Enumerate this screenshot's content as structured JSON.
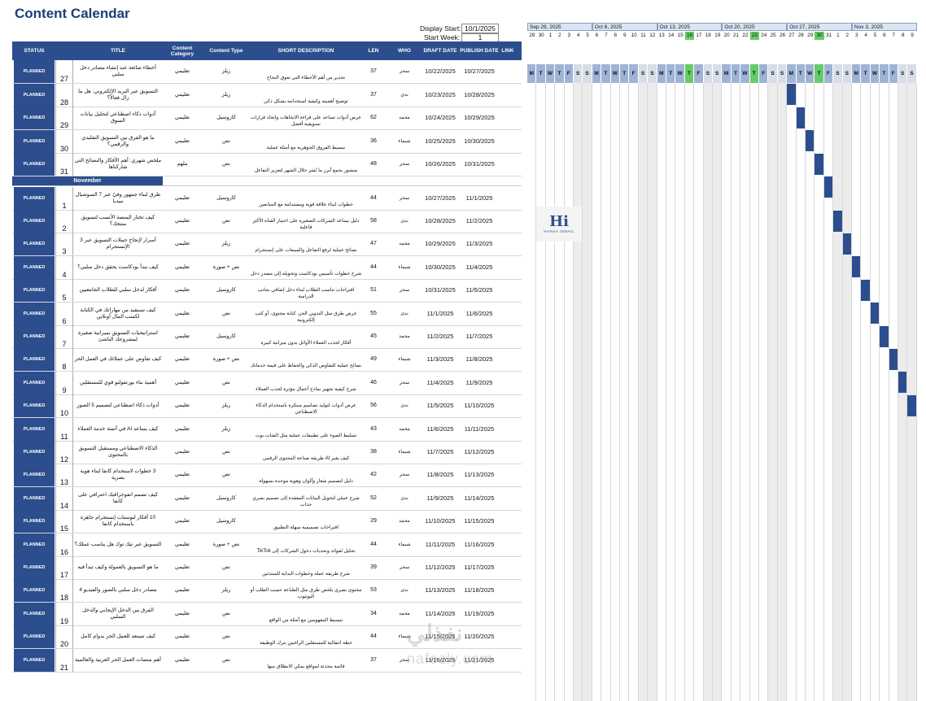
{
  "page_title": "Content Calendar",
  "display_start_label": "Display Start:",
  "display_start_value": "10/1/2025",
  "start_week_label": "Start Week:",
  "start_week_value": "1",
  "columns": [
    "STATUS",
    "TITLE",
    "Content Category",
    "Content Type",
    "SHORT DESCRIPTION",
    "LEN",
    "WHO",
    "DRAFT DATE",
    "PUBLISH DATE",
    "LINK"
  ],
  "month_label": "November",
  "week_labels": [
    "Sep 29, 2025",
    "Oct 6, 2025",
    "Oct 13, 2025",
    "Oct 20, 2025",
    "Oct 27, 2025",
    "Nov 3, 2025"
  ],
  "day_numbers": [
    "29",
    "30",
    "1",
    "2",
    "3",
    "4",
    "5",
    "6",
    "7",
    "8",
    "9",
    "10",
    "11",
    "12",
    "13",
    "14",
    "15",
    "16",
    "17",
    "18",
    "19",
    "20",
    "21",
    "22",
    "23",
    "24",
    "25",
    "26",
    "27",
    "28",
    "29",
    "30",
    "31",
    "1",
    "2",
    "3",
    "4",
    "5",
    "6",
    "7",
    "8",
    "9"
  ],
  "day_letters": [
    "M",
    "T",
    "W",
    "T",
    "F",
    "S",
    "S"
  ],
  "colors": {
    "header": "#2c4e8f",
    "today": "#66cc66",
    "weekend": "#ececec",
    "bar": "#2c4e8f"
  },
  "logo": {
    "mark": "Hi",
    "text": "HANAA ISMAIL"
  },
  "watermark": {
    "arabic": "نفذلي",
    "latin": "nafezly.com"
  },
  "rows_oct": [
    {
      "status": "PLANNED",
      "num": "27",
      "title": "أخطاء شائعة عند إنشاء مصادر دخل سلبي",
      "category": "تعليمي",
      "type": "ريلز",
      "desc": "تحذير من أهم الأخطاء التي تعوق النجاح",
      "len": "37",
      "who": "سحر",
      "draft": "10/22/2025",
      "publish": "10/27/2025"
    },
    {
      "status": "PLANNED",
      "num": "28",
      "title": "التسويق عبر البريد الإلكتروني: هل ما زال فعالاً؟",
      "category": "تعليمي",
      "type": "ريلز",
      "desc": "توضيح أهميته وكيفية استخدامه بشكل ذكي",
      "len": "37",
      "who": "ندى",
      "draft": "10/23/2025",
      "publish": "10/28/2025"
    },
    {
      "status": "PLANNED",
      "num": "29",
      "title": "أدوات ذكاء اصطناعي لتحليل بيانات السوق",
      "category": "تعليمي",
      "type": "كاروسيل",
      "desc": "عرض أدوات تساعد على قراءة الاتجاهات واتخاذ قرارات تسويقية أفضل",
      "len": "62",
      "who": "محمد",
      "draft": "10/24/2025",
      "publish": "10/29/2025"
    },
    {
      "status": "PLANNED",
      "num": "30",
      "title": "ما هو الفرق بين التسويق التقليدي والرقمي؟",
      "category": "تعليمي",
      "type": "نص",
      "desc": "تبسيط الفروق الجوهرية مع أمثلة عملية",
      "len": "36",
      "who": "شيماء",
      "draft": "10/25/2025",
      "publish": "10/30/2025"
    },
    {
      "status": "PLANNED",
      "num": "31",
      "title": "ملخص شهري: أهم الأفكار والنصائح التي شاركناها",
      "category": "ملهم",
      "type": "نص",
      "desc": "منشور يجمع أبرز ما نُشر خلال الشهر لتعزيز التفاعل",
      "len": "48",
      "who": "سحر",
      "draft": "10/26/2025",
      "publish": "10/31/2025"
    }
  ],
  "rows_nov": [
    {
      "status": "PLANNED",
      "num": "1",
      "title": "طرق لبناء جمهور وفيّ عبر 7 السوشيال ميديا",
      "category": "تعليمي",
      "type": "كاروسيل",
      "desc": "خطوات لبناء علاقة قوية ومستدامة مع المتابعين",
      "len": "44",
      "who": "سحر",
      "draft": "10/27/2025",
      "publish": "11/1/2025"
    },
    {
      "status": "PLANNED",
      "num": "2",
      "title": "كيف تختار المنصة الأنسب لتسويق منتجك؟",
      "category": "تعليمي",
      "type": "نص",
      "desc": "دليل يساعد الشركات الصغيرة على اختيار القناة الأكثر فاعلية",
      "len": "58",
      "who": "ندى",
      "draft": "10/28/2025",
      "publish": "11/2/2025"
    },
    {
      "status": "PLANNED",
      "num": "3",
      "title": "أسرار لإنجاح حملات التسويق عبر 3 الإنستجرام",
      "category": "تعليمي",
      "type": "ريلز",
      "desc": "نصائح عملية لرفع التفاعل والمبيعات على إنستجرام",
      "len": "47",
      "who": "محمد",
      "draft": "10/29/2025",
      "publish": "11/3/2025"
    },
    {
      "status": "PLANNED",
      "num": "4",
      "title": "كيف تبدأ بودكاست يحقق دخل سلبي؟",
      "category": "تعليمي",
      "type": "نص + صورة",
      "desc": "شرح خطوات تأسيس بودكاست وتحويله إلى مصدر دخل",
      "len": "44",
      "who": "شيماء",
      "draft": "10/30/2025",
      "publish": "11/4/2025"
    },
    {
      "status": "PLANNED",
      "num": "5",
      "title": "أفكار لدخل سلبي للطلاب الجامعيين",
      "category": "تعليمي",
      "type": "كاروسيل",
      "desc": "اقتراحات تناسب الطلاب لبناء دخل إضافي بجانب الدراسة",
      "len": "51",
      "who": "سحر",
      "draft": "10/31/2025",
      "publish": "11/5/2025"
    },
    {
      "status": "PLANNED",
      "num": "6",
      "title": "كيف تستفيد من مهاراتك في الكتابة لكسب المال أونلاين",
      "category": "تعليمي",
      "type": "نص",
      "desc": "عرض طرق مثل التدوين الحر، كتابة محتوى، أو كتب إلكترونية",
      "len": "55",
      "who": "ندى",
      "draft": "11/1/2025",
      "publish": "11/6/2025"
    },
    {
      "status": "PLANNED",
      "num": "7",
      "title": "استراتيجيات التسويق بميزانية صغيرة لمشروعك الناشئ",
      "category": "تعليمي",
      "type": "كاروسيل",
      "desc": "أفكار لجذب العملاء الأوائل بدون ميزانية كبيرة",
      "len": "45",
      "who": "محمد",
      "draft": "11/2/2025",
      "publish": "11/7/2025"
    },
    {
      "status": "PLANNED",
      "num": "8",
      "title": "كيف تفاوض على عملائك في العمل الحر",
      "category": "تعليمي",
      "type": "نص + صورة",
      "desc": "نصائح عملية للتفاوض الذكي والحفاظ على قيمة خدماتك",
      "len": "49",
      "who": "شيماء",
      "draft": "11/3/2025",
      "publish": "11/8/2025"
    },
    {
      "status": "PLANNED",
      "num": "9",
      "title": "أهمية بناء بورتفوليو قوي للمستقلين",
      "category": "تعليمي",
      "type": "نص",
      "desc": "شرح كيفية تجهيز نماذج أعمال مؤثرة لجذب العملاء",
      "len": "46",
      "who": "سحر",
      "draft": "11/4/2025",
      "publish": "11/9/2025"
    },
    {
      "status": "PLANNED",
      "num": "10",
      "title": "أدوات ذكاء اصطناعي لتصميم 5 الصور",
      "category": "تعليمي",
      "type": "ريلز",
      "desc": "عرض أدوات لتوليد تصاميم مبتكرة باستخدام الذكاء الاصطناعي",
      "len": "56",
      "who": "ندى",
      "draft": "11/5/2025",
      "publish": "11/10/2025"
    },
    {
      "status": "PLANNED",
      "num": "11",
      "title": "كيف يساعد AI في أتمتة خدمة العملاء",
      "category": "تعليمي",
      "type": "ريلز",
      "desc": "تسليط الضوء على تطبيقات عملية مثل الشات بوت",
      "len": "43",
      "who": "محمد",
      "draft": "11/6/2025",
      "publish": "11/11/2025"
    },
    {
      "status": "PLANNED",
      "num": "12",
      "title": "الذكاء الاصطناعي ومستقبل التسويق بالمحتوى",
      "category": "تعليمي",
      "type": "نص",
      "desc": "كيف يغير AI طريقة صناعة المحتوى الرقمي",
      "len": "38",
      "who": "شيماء",
      "draft": "11/7/2025",
      "publish": "11/12/2025"
    },
    {
      "status": "PLANNED",
      "num": "13",
      "title": "3 خطوات لاستخدام كانفا لبناء هوية بصرية",
      "category": "تعليمي",
      "type": "نص",
      "desc": "دليل لتصميم شعار وألوان وهوية موحدة بسهولة",
      "len": "42",
      "who": "سحر",
      "draft": "11/8/2025",
      "publish": "11/13/2025"
    },
    {
      "status": "PLANNED",
      "num": "14",
      "title": "كيف تصمم انفوجرافيك احترافي على كانفا",
      "category": "تعليمي",
      "type": "كاروسيل",
      "desc": "شرح عملي لتحويل البيانات المعقدة إلى تصميم بصري جذاب",
      "len": "52",
      "who": "ندى",
      "draft": "11/9/2025",
      "publish": "11/14/2025"
    },
    {
      "status": "PLANNED",
      "num": "15",
      "title": "10 أفكار لبوستات إنستجرام جاهزة باستخدام كانفا",
      "category": "تعليمي",
      "type": "كاروسيل",
      "desc": "اقتراحات تصميمية سهلة التطبيق",
      "len": "29",
      "who": "محمد",
      "draft": "11/10/2025",
      "publish": "11/15/2025"
    },
    {
      "status": "PLANNED",
      "num": "16",
      "title": "التسويق عبر تيك توك هل يناسب عملك؟",
      "category": "تعليمي",
      "type": "نص + صورة",
      "desc": "تحليل لفوائد وتحديات دخول الشركات إلى TikTok",
      "len": "44",
      "who": "شيماء",
      "draft": "11/11/2025",
      "publish": "11/16/2025"
    },
    {
      "status": "PLANNED",
      "num": "17",
      "title": "ما هو التسويق بالعمولة وكيف تبدأ فيه",
      "category": "تعليمي",
      "type": "نص",
      "desc": "شرح طريقة عمله وخطوات البداية للمبتدئين",
      "len": "39",
      "who": "سحر",
      "draft": "11/12/2025",
      "publish": "11/17/2025"
    },
    {
      "status": "PLANNED",
      "num": "18",
      "title": "مصادر دخل سلبي بالصور والفيديو 4",
      "category": "تعليمي",
      "type": "ريلز",
      "desc": "محتوى بصري يلخص طرق مثل الطباعة حسب الطلب أو اليوتيوب",
      "len": "53",
      "who": "ندى",
      "draft": "11/13/2025",
      "publish": "11/18/2025"
    },
    {
      "status": "PLANNED",
      "num": "19",
      "title": "الفرق بين الدخل الإيجابي والدخل السلبي",
      "category": "تعليمي",
      "type": "نص",
      "desc": "تبسيط المفهومين مع أمثلة من الواقع",
      "len": "34",
      "who": "محمد",
      "draft": "11/14/2025",
      "publish": "11/19/2025"
    },
    {
      "status": "PLANNED",
      "num": "20",
      "title": "كيف تستعد للعمل الحر بدوام كامل",
      "category": "تعليمي",
      "type": "نص",
      "desc": "خطة انتقالية للمستقلين الراغبين بترك الوظيفة",
      "len": "44",
      "who": "شيماء",
      "draft": "11/15/2025",
      "publish": "11/20/2025"
    },
    {
      "status": "PLANNED",
      "num": "21",
      "title": "أهم منصات العمل الحر العربية والعالمية",
      "category": "تعليمي",
      "type": "نص",
      "desc": "قائمة محدثة لمواقع يمكن الانطلاق منها",
      "len": "37",
      "who": "سحر",
      "draft": "11/16/2025",
      "publish": "11/21/2025"
    }
  ]
}
